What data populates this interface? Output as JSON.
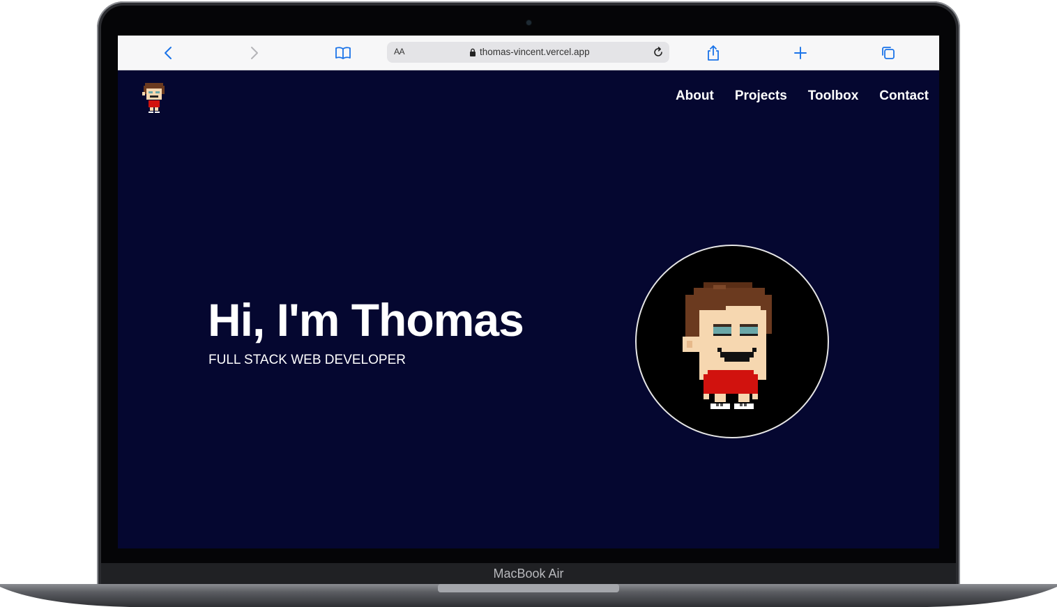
{
  "device": {
    "label": "MacBook Air"
  },
  "browser": {
    "text_size_label": "AA",
    "url": "thomas-vincent.vercel.app",
    "icons": {
      "back": "chevron-left-icon",
      "forward": "chevron-right-icon",
      "bookmarks": "book-icon",
      "lock": "lock-icon",
      "reload": "reload-icon",
      "share": "share-icon",
      "new_tab": "plus-icon",
      "tabs": "tabs-icon"
    },
    "accent_color": "#1a73e8"
  },
  "site": {
    "background_color": "#050730",
    "logo": "avatar-logo-icon",
    "nav": [
      {
        "label": "About"
      },
      {
        "label": "Projects"
      },
      {
        "label": "Toolbox"
      },
      {
        "label": "Contact"
      }
    ],
    "hero": {
      "title": "Hi, I'm Thomas",
      "subtitle": "FULL STACK WEB DEVELOPER",
      "avatar": "pixel-avatar-image"
    }
  }
}
